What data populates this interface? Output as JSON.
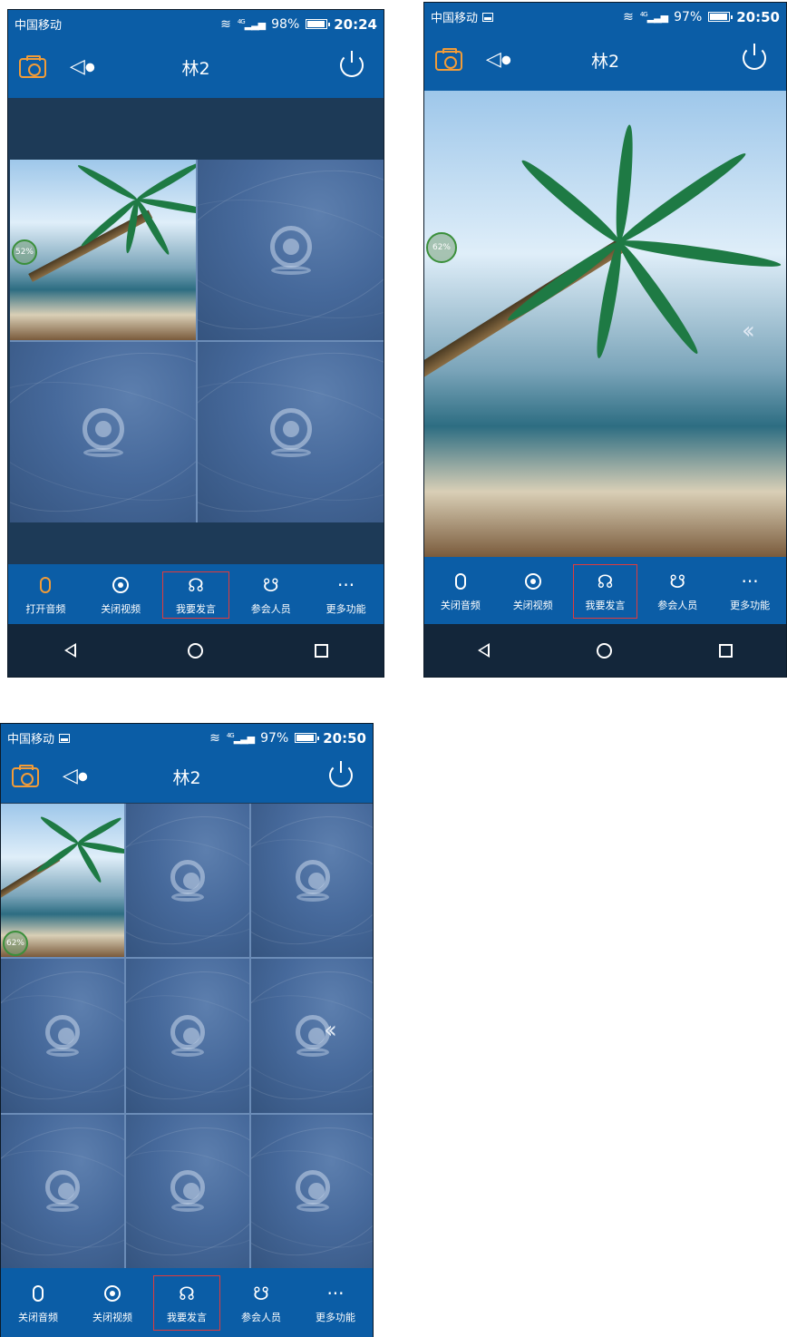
{
  "screens": [
    {
      "carrier": "中国移动",
      "signal": "4G",
      "battery": "98%",
      "battery_level": 0.98,
      "time": "20:24",
      "title": "林2",
      "progress_badge": "52%",
      "toolbar": [
        "打开音频",
        "关闭视频",
        "我要发言",
        "参会人员",
        "更多功能"
      ]
    },
    {
      "carrier": "中国移动",
      "signal": "4G",
      "battery": "97%",
      "battery_level": 0.97,
      "time": "20:50",
      "title": "林2",
      "progress_badge": "62%",
      "toolbar": [
        "关闭音频",
        "关闭视频",
        "我要发言",
        "参会人员",
        "更多功能"
      ]
    },
    {
      "carrier": "中国移动",
      "signal": "4G",
      "battery": "97%",
      "battery_level": 0.97,
      "time": "20:50",
      "title": "林2",
      "progress_badge": "62%",
      "toolbar": [
        "关闭音频",
        "关闭视频",
        "我要发言",
        "参会人员",
        "更多功能"
      ]
    }
  ],
  "colors": {
    "header_blue": "#0b5da6",
    "accent_orange": "#f29c38",
    "highlight_red": "#e23b3b",
    "nav_dark": "#13263a"
  },
  "icons": [
    "camera-switch-icon",
    "speaker-icon",
    "power-icon",
    "microphone-icon",
    "webcam-icon",
    "raise-hand-speak-icon",
    "participants-icon",
    "more-icon",
    "back-icon",
    "home-icon",
    "recent-apps-icon"
  ]
}
